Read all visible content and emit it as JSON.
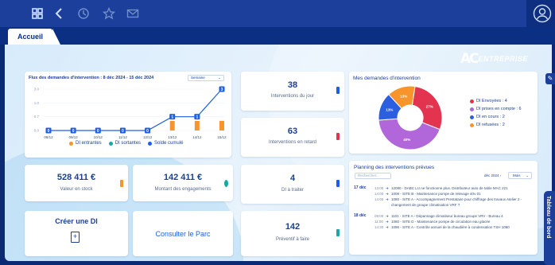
{
  "tab": {
    "label": "Accueil"
  },
  "logo": {
    "mark": "AC",
    "text": "ENTREPRISE"
  },
  "flux": {
    "title": "Flux des demandes d'intervention : 8 déc 2024 - 15 déc 2024",
    "select": "Semaine",
    "legend": {
      "entrees": "DI entrantes",
      "sorties": "DI sortantes",
      "solde": "Solde cumulé"
    },
    "colors": {
      "entrees": "#f7942b",
      "sorties": "#1ca5a5",
      "solde": "#1e5ee6"
    }
  },
  "chart_data": {
    "type": "bar",
    "categories": [
      "08/12",
      "09/12",
      "10/12",
      "11/12",
      "12/12",
      "13/12",
      "14/12",
      "15/12"
    ],
    "series": [
      {
        "name": "DI entrantes",
        "values": [
          0,
          0,
          0,
          0,
          0,
          1,
          1,
          1
        ]
      },
      {
        "name": "DI sortantes",
        "values": [
          0,
          0,
          0,
          0,
          0,
          0,
          0,
          0
        ]
      },
      {
        "name": "Solde cumulé",
        "values": [
          0,
          0,
          0,
          0,
          0,
          1,
          1,
          3
        ]
      }
    ],
    "y_ticks": [
      "3.0",
      "1.0",
      "0.7",
      "0.0"
    ],
    "ylim": [
      0,
      3
    ]
  },
  "kpis": {
    "jour": {
      "value": "38",
      "label": "Interventions du jour"
    },
    "retard": {
      "value": "63",
      "label": "Interventions en retard"
    },
    "stock": {
      "value": "528 411 €",
      "label": "Valeur en stock"
    },
    "engagements": {
      "value": "142 411 €",
      "label": "Montant des engagements"
    },
    "traiter": {
      "value": "4",
      "label": "DI à traiter"
    },
    "preventif": {
      "value": "142",
      "label": "Préventif à faire"
    }
  },
  "create_di": {
    "label": "Créer une DI"
  },
  "parc": {
    "label": "Consulter le Parc"
  },
  "mes_demandes": {
    "title": "Mes demandes d'intervention",
    "slices": [
      {
        "label": "DI Envoyées : 4",
        "value": 4,
        "pct": "27%",
        "color": "#e2344f"
      },
      {
        "label": "DI prises en compte : 6",
        "value": 6,
        "pct": "40%",
        "color": "#b166d9"
      },
      {
        "label": "DI en cours : 2",
        "value": 2,
        "pct": "13%",
        "color": "#2b5fe0"
      },
      {
        "label": "DI refusées : 2",
        "value": 2,
        "pct": "13%",
        "color": "#f7942b"
      }
    ]
  },
  "planning": {
    "title": "Planning des interventions prévues",
    "search": "Rechercher...",
    "date_nav": "déc 2024",
    "period": "Mois",
    "days": [
      {
        "date": "17 déc",
        "items": [
          {
            "time": "13:00",
            "text": "12080 - DABC LU ne fonctionne plus. Distributeur auto de table MAC 221"
          },
          {
            "time": "14:00",
            "text": "1009 - SITE B - Maintenance pompe de relevage 40v 01"
          },
          {
            "time": "14:00",
            "text": "1080 - SITE A - Accompagnement Prestataire pour chiffrage des travaux Atelier 2 - changement de groupe climatisation VRF T"
          }
        ]
      },
      {
        "date": "18 déc",
        "items": [
          {
            "time": "09:00",
            "text": "1101 - SITE A - Dépannage climatiseur bureau groupe VRV - Bureau 4"
          },
          {
            "time": "11:00",
            "text": "1080 - SITE D - Maintenance pompe de circulation eau glacée"
          },
          {
            "time": "14:30",
            "text": "1096 - SITE A - Contrôle annuel de la chaudière à condensation TSH 1080"
          }
        ]
      }
    ]
  },
  "side_tab": {
    "label": "Tableau de bord"
  }
}
